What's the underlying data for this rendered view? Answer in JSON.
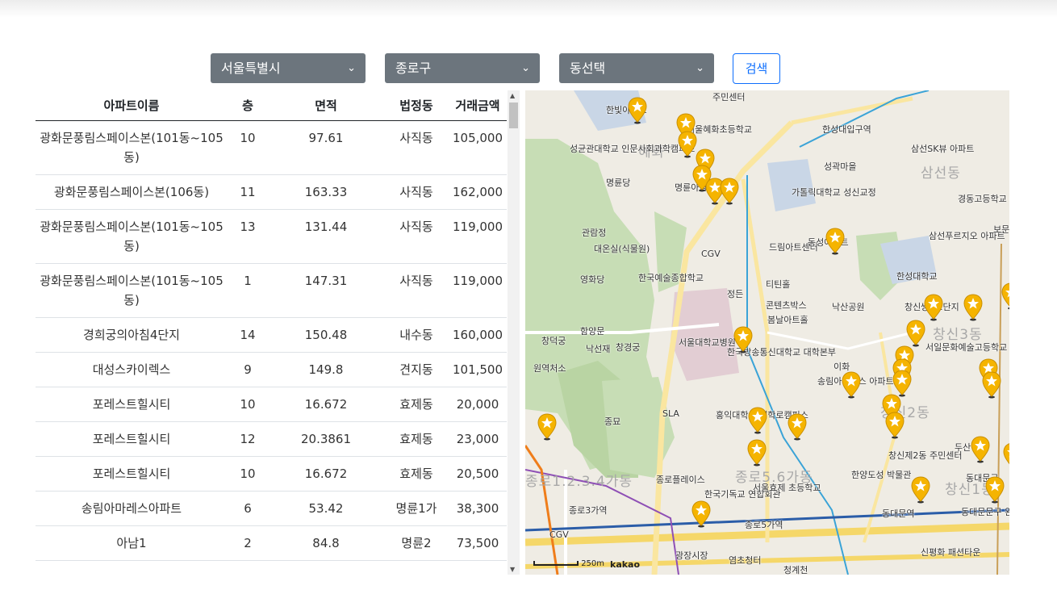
{
  "filters": {
    "city": "서울특별시",
    "district": "종로구",
    "dong": "동선택",
    "search_label": "검색"
  },
  "table": {
    "headers": [
      "아파트이름",
      "층",
      "면적",
      "법정동",
      "거래금액"
    ],
    "rows": [
      {
        "name": "광화문풍림스페이스본(101동~105동)",
        "floor": "10",
        "area": "97.61",
        "dong": "사직동",
        "price": "105,000"
      },
      {
        "name": "광화문풍림스페이스본(106동)",
        "floor": "11",
        "area": "163.33",
        "dong": "사직동",
        "price": "162,000"
      },
      {
        "name": "광화문풍림스페이스본(101동~105동)",
        "floor": "13",
        "area": "131.44",
        "dong": "사직동",
        "price": "119,000"
      },
      {
        "name": "광화문풍림스페이스본(101동~105동)",
        "floor": "1",
        "area": "147.31",
        "dong": "사직동",
        "price": "119,000"
      },
      {
        "name": "경희궁의아침4단지",
        "floor": "14",
        "area": "150.48",
        "dong": "내수동",
        "price": "160,000"
      },
      {
        "name": "대성스카이렉스",
        "floor": "9",
        "area": "149.8",
        "dong": "견지동",
        "price": "101,500"
      },
      {
        "name": "포레스트힐시티",
        "floor": "10",
        "area": "16.672",
        "dong": "효제동",
        "price": "20,000"
      },
      {
        "name": "포레스트힐시티",
        "floor": "12",
        "area": "20.3861",
        "dong": "효제동",
        "price": "23,000"
      },
      {
        "name": "포레스트힐시티",
        "floor": "10",
        "area": "16.672",
        "dong": "효제동",
        "price": "20,500"
      },
      {
        "name": "송림아마레스아파트",
        "floor": "6",
        "area": "53.42",
        "dong": "명륜1가",
        "price": "38,300"
      },
      {
        "name": "아남1",
        "floor": "2",
        "area": "84.8",
        "dong": "명륜2",
        "price": "73,500"
      }
    ]
  },
  "map": {
    "labels": [
      {
        "text": "한빛아파트"
      },
      {
        "text": "주민센터"
      },
      {
        "text": "서울혜화초등학교"
      },
      {
        "text": "성균관대학교 인문사회과학캠퍼스"
      },
      {
        "text": "명륜당"
      },
      {
        "text": "명륜아남 아파트"
      },
      {
        "text": "가톨릭대학교 성신교정"
      },
      {
        "text": "삼선SK뷰 아파트"
      },
      {
        "text": "경동고등학교"
      },
      {
        "text": "관람정"
      },
      {
        "text": "대온실(식물원)"
      },
      {
        "text": "CGV"
      },
      {
        "text": "드림아트센터"
      },
      {
        "text": "동성아파트"
      },
      {
        "text": "삼선푸르지오 아파트"
      },
      {
        "text": "영화당"
      },
      {
        "text": "한국예술종합학교"
      },
      {
        "text": "정든"
      },
      {
        "text": "티틴홀"
      },
      {
        "text": "한성대학교"
      },
      {
        "text": "콘텐츠박스"
      },
      {
        "text": "낙산공원"
      },
      {
        "text": "봄날아트홀"
      },
      {
        "text": "창신쌍용2단지"
      },
      {
        "text": "함양문"
      },
      {
        "text": "창덕궁"
      },
      {
        "text": "낙선재"
      },
      {
        "text": "창경궁"
      },
      {
        "text": "서울대학교병원"
      },
      {
        "text": "한국방송통신대학교 대학본부"
      },
      {
        "text": "서일문화예술고등학교"
      },
      {
        "text": "원역처소"
      },
      {
        "text": "이화"
      },
      {
        "text": "송림아마레스 아파트"
      },
      {
        "text": "SLA"
      },
      {
        "text": "홍익대학교 대학로캠퍼스"
      },
      {
        "text": "종묘"
      },
      {
        "text": "창신제2동 주민센터"
      },
      {
        "text": "두산"
      },
      {
        "text": "종로플레이스"
      },
      {
        "text": "한국기독교 연합회관"
      },
      {
        "text": "서울효제 초등학교"
      },
      {
        "text": "한양도성 박물관"
      },
      {
        "text": "동대문구"
      },
      {
        "text": "종로3가역"
      },
      {
        "text": "종로5가역"
      },
      {
        "text": "동대문역"
      },
      {
        "text": "동대문문구 완구시장"
      },
      {
        "text": "CGV"
      },
      {
        "text": "광장시장"
      },
      {
        "text": "염초청터"
      },
      {
        "text": "청계천"
      },
      {
        "text": "신평화 패션타운"
      },
      {
        "text": "한성대입구역"
      },
      {
        "text": "성곽마을"
      },
      {
        "text": "보문"
      }
    ],
    "district_labels": [
      "혜화",
      "삼선동",
      "창신3동",
      "창신2동",
      "종로5.6가동",
      "창신1동",
      "종로1.2.3.4가동"
    ],
    "scale": "250m",
    "brand": "kakao",
    "pin_count": 30
  },
  "colors": {
    "select_bg": "#6c757d",
    "button_accent": "#0d6efd",
    "pin": "#f5b400"
  }
}
